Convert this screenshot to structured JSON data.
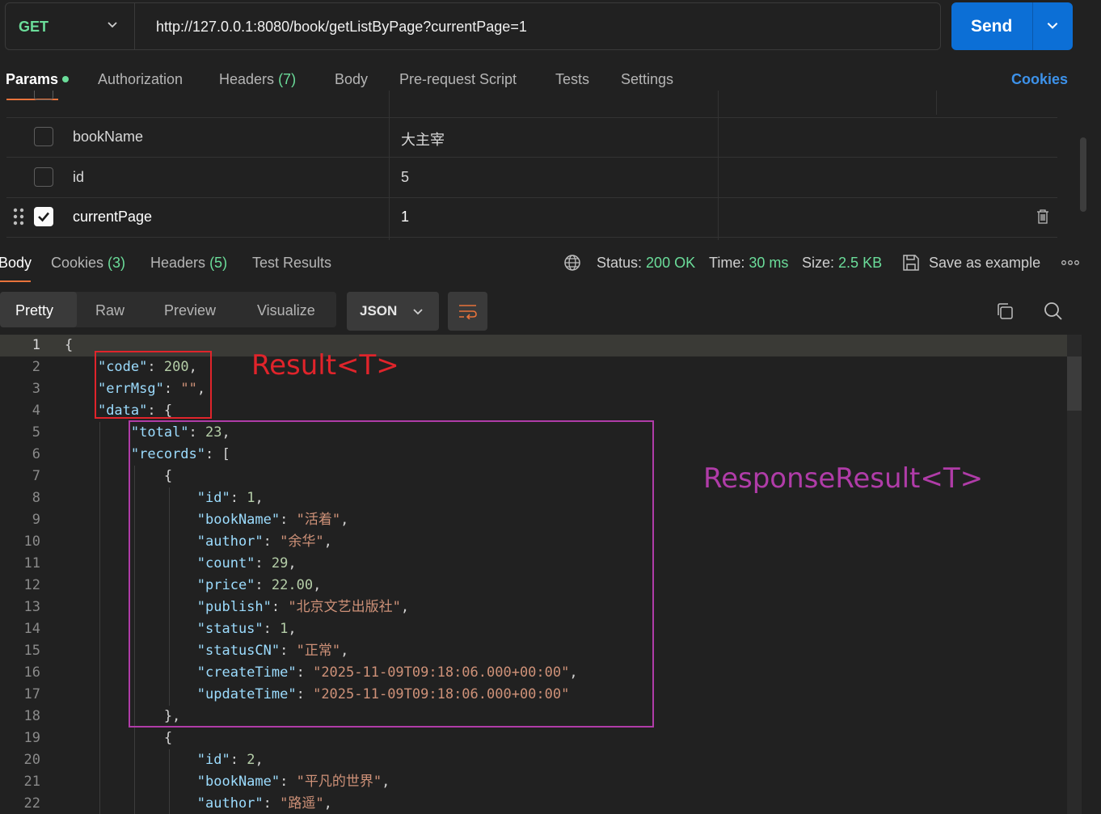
{
  "request": {
    "method": "GET",
    "url": "http://127.0.0.1:8080/book/getListByPage?currentPage=1",
    "send_label": "Send"
  },
  "request_tabs": [
    {
      "label": "Params",
      "active": true
    },
    {
      "label": "Authorization"
    },
    {
      "label": "Headers",
      "count": "(7)"
    },
    {
      "label": "Body"
    },
    {
      "label": "Pre-request Script"
    },
    {
      "label": "Tests"
    },
    {
      "label": "Settings"
    }
  ],
  "cookies_link": "Cookies",
  "params": {
    "rows": [
      {
        "key": "bookName",
        "value": "大主宰",
        "checked": false
      },
      {
        "key": "id",
        "value": "5",
        "checked": false
      },
      {
        "key": "currentPage",
        "value": "1",
        "checked": true
      }
    ]
  },
  "response_tabs": [
    {
      "label": "Body",
      "active": true
    },
    {
      "label": "Cookies",
      "count": "(3)"
    },
    {
      "label": "Headers",
      "count": "(5)"
    },
    {
      "label": "Test Results"
    }
  ],
  "response_meta": {
    "status_label": "Status:",
    "status_value": "200 OK",
    "time_label": "Time:",
    "time_value": "30 ms",
    "size_label": "Size:",
    "size_value": "2.5 KB",
    "save_label": "Save as example"
  },
  "view_modes": [
    "Pretty",
    "Raw",
    "Preview",
    "Visualize"
  ],
  "format": "JSON",
  "annotations": {
    "result": "Result<T>",
    "response_result": "ResponseResult<T>"
  },
  "colors": {
    "send": "#0c6fd6",
    "green": "#6bdd9a",
    "accent": "#e8733b",
    "annotation_red": "#e0242b",
    "annotation_purple": "#b03ca8"
  }
}
